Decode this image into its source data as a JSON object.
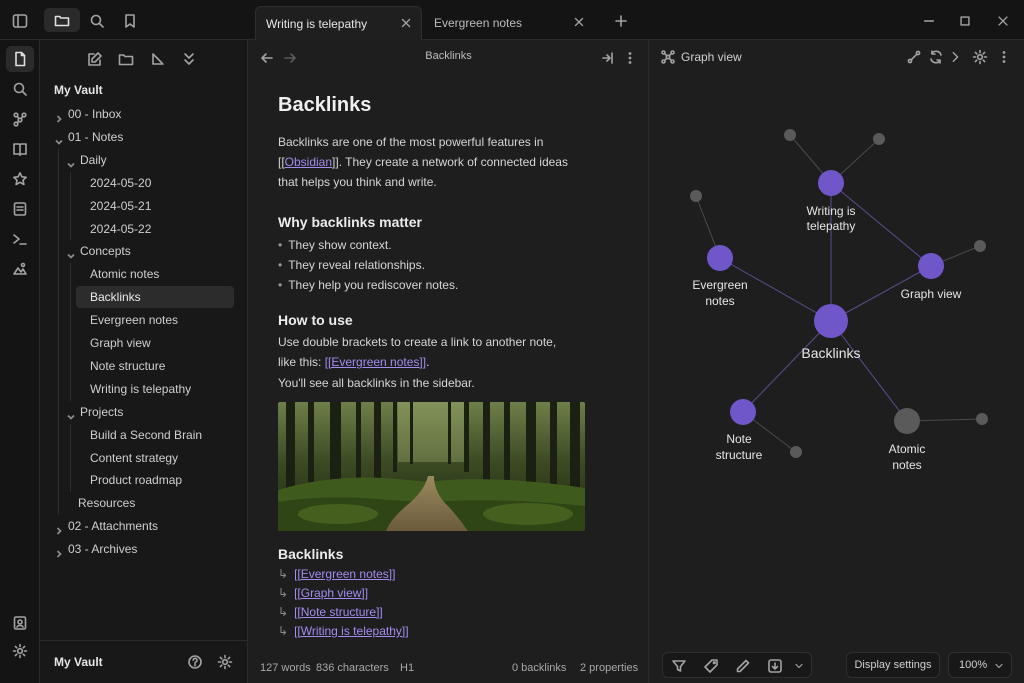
{
  "tabs": [
    {
      "label": "Writing is telepathy",
      "active": true
    },
    {
      "label": "Evergreen notes",
      "active": false
    }
  ],
  "sidebar": {
    "vault_name": "My Vault",
    "tree": [
      {
        "label": "00 - Inbox",
        "level": 0,
        "folder": true,
        "expanded": false
      },
      {
        "label": "01 - Notes",
        "level": 0,
        "folder": true,
        "expanded": true
      },
      {
        "label": "Daily",
        "level": 1,
        "folder": true,
        "expanded": true
      },
      {
        "label": "2024-05-20",
        "level": 2,
        "folder": false
      },
      {
        "label": "2024-05-21",
        "level": 2,
        "folder": false
      },
      {
        "label": "2024-05-22",
        "level": 2,
        "folder": false
      },
      {
        "label": "Concepts",
        "level": 1,
        "folder": true,
        "expanded": true
      },
      {
        "label": "Atomic notes",
        "level": 2,
        "folder": false
      },
      {
        "label": "Backlinks",
        "level": 2,
        "folder": false,
        "selected": true
      },
      {
        "label": "Evergreen notes",
        "level": 2,
        "folder": false
      },
      {
        "label": "Graph view",
        "level": 2,
        "folder": false
      },
      {
        "label": "Note structure",
        "level": 2,
        "folder": false
      },
      {
        "label": "Writing is telepathy",
        "level": 2,
        "folder": false
      },
      {
        "label": "Projects",
        "level": 1,
        "folder": true,
        "expanded": true
      },
      {
        "label": "Build a Second Brain",
        "level": 2,
        "folder": false
      },
      {
        "label": "Content strategy",
        "level": 2,
        "folder": false
      },
      {
        "label": "Product roadmap",
        "level": 2,
        "folder": false
      },
      {
        "label": "Resources",
        "level": 1,
        "folder": false
      },
      {
        "label": "02 - Attachments",
        "level": 0,
        "folder": true,
        "expanded": false
      },
      {
        "label": "03 - Archives",
        "level": 0,
        "folder": true,
        "expanded": false
      }
    ],
    "footer_name": "My Vault"
  },
  "editor": {
    "header_title": "Backlinks",
    "title": "Backlinks",
    "intro_line1": "Backlinks are one of the most powerful features in",
    "intro_open": "[[",
    "intro_link": "Obsidian",
    "intro_close": "]]. They create a network of connected ideas",
    "intro_line3": "that helps you think and write.",
    "h_why": "Why backlinks matter",
    "bullets": [
      "They show context.",
      "They reveal relationships.",
      "They help you rediscover notes."
    ],
    "h_how": "How to use",
    "how_line1": "Use double brackets to create a link to another note,",
    "how_line2_prefix": "like this: ",
    "how_line2_link": "[[Evergreen notes]]",
    "how_line2_suffix": ".",
    "how_line3": "You'll see all backlinks in the sidebar.",
    "h_backlinks": "Backlinks",
    "backlinks": [
      "[[Evergreen notes]]",
      "[[Graph view]]",
      "[[Note structure]]",
      "[[Writing is telepathy]]"
    ],
    "backlink_arrow": "↳"
  },
  "status_bar": {
    "words": "127 words",
    "characters": "836 characters",
    "heading": "H1",
    "backlinks": "0 backlinks",
    "properties": "2 properties"
  },
  "graph": {
    "title": "Graph view",
    "node_color": "#7057c9",
    "grey_node_color": "#5a5a5a",
    "labels": {
      "writing": [
        "Writing is",
        "telepathy"
      ],
      "evergreen": [
        "Evergreen",
        "notes"
      ],
      "graph": [
        "Graph view"
      ],
      "backlinks": [
        "Backlinks"
      ],
      "note_structure": [
        "Note",
        "structure"
      ],
      "atomic": [
        "Atomic",
        "notes"
      ]
    },
    "display_settings": "Display settings",
    "zoom": "100%"
  },
  "colors": {
    "accent": "#a48cf0",
    "background": "#1e1e1e",
    "sidebar": "#181818",
    "chrome": "#141414"
  }
}
